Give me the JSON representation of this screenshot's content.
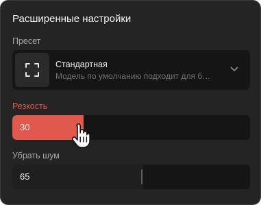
{
  "panel": {
    "title": "Расширенные настройки"
  },
  "preset": {
    "label": "Пресет",
    "name": "Стандартная",
    "description": "Модель по умолчанию подходит для бол...",
    "icon": "focus-frame-icon",
    "dropdown_icon": "chevron-down-icon"
  },
  "sharpness": {
    "label": "Резкость",
    "value": "30",
    "fill_fraction": 0.3,
    "accent_color": "#e1584c"
  },
  "denoise": {
    "label": "Убрать шум",
    "value": "65",
    "fill_fraction": 0.55
  },
  "cursor": {
    "icon": "hand-pointer-icon"
  }
}
